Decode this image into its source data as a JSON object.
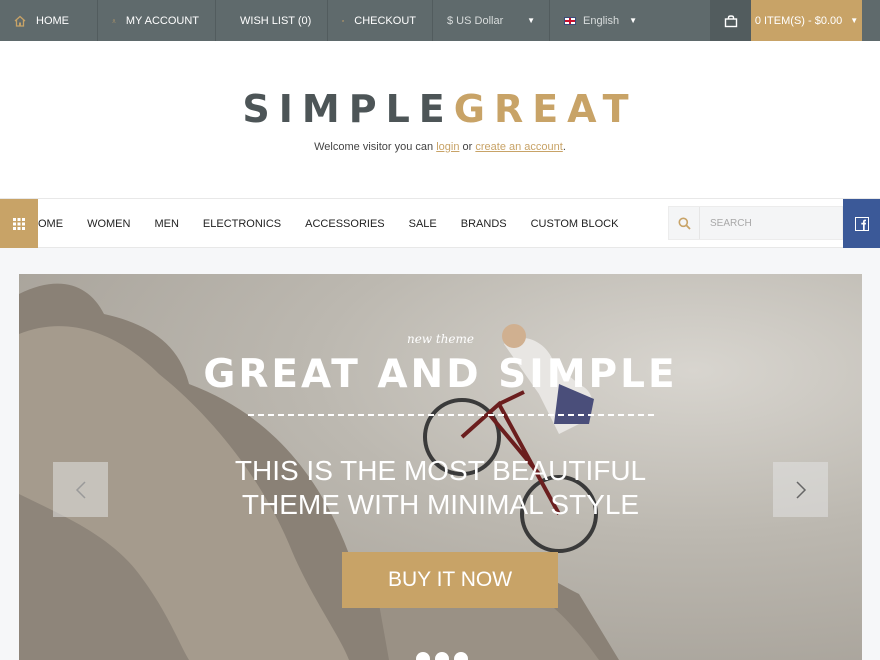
{
  "topbar": {
    "home": "Home",
    "my_account": "My Account",
    "wish_list": "Wish List (0)",
    "checkout": "Checkout",
    "currency": "$ US Dollar",
    "language": "English",
    "cart": "0 item(s) - $0.00"
  },
  "header": {
    "logo_part1": "SIMPLE",
    "logo_part2": "GREAT",
    "welcome_prefix": "Welcome visitor you can",
    "login": "login",
    "or": "or",
    "create_account": "create an account",
    "period": "."
  },
  "nav": {
    "items": [
      "ome",
      "Women",
      "Men",
      "Electronics",
      "Accessories",
      "Sale",
      "Brands",
      "Custom Block"
    ],
    "search_placeholder": "SEARCH"
  },
  "slider": {
    "kicker": "new theme",
    "headline": "Great and Simple",
    "line1": "This is the most beautiful",
    "line2": "theme with minimal style",
    "button": "Buy it now",
    "dots": 3
  },
  "colors": {
    "topbar": "#5f6a6c",
    "accent": "#c8a367",
    "facebook": "#3b5998"
  },
  "icons": [
    "home-icon",
    "user-icon",
    "heart-icon",
    "checkbox-icon",
    "bag-icon",
    "grid-icon",
    "search-icon",
    "facebook-icon",
    "chevron-left-icon",
    "chevron-right-icon"
  ]
}
